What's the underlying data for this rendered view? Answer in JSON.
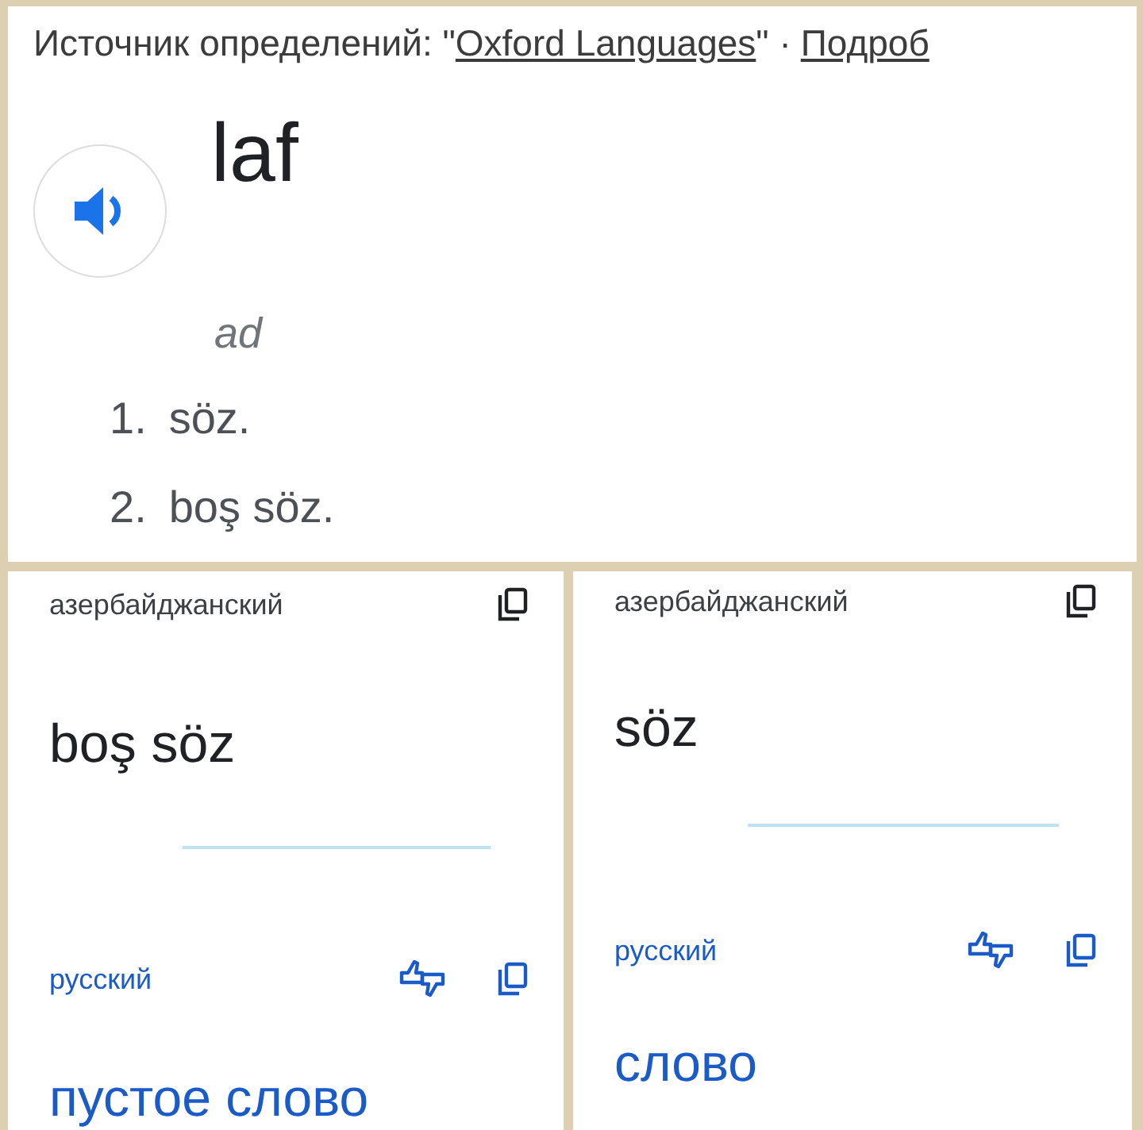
{
  "source": {
    "prefix": "Источник определений: \"",
    "link": "Oxford Languages",
    "suffix": "\" ·",
    "more_link": "Подроб"
  },
  "entry": {
    "word": "laf",
    "part_of_speech": "ad",
    "senses": [
      {
        "number": "1.",
        "text": "söz."
      },
      {
        "number": "2.",
        "text": "boş söz."
      }
    ]
  },
  "translations": [
    {
      "source_lang": "азербайджанский",
      "source_text": "boş söz",
      "target_lang": "русский",
      "target_text": "пустое слово"
    },
    {
      "source_lang": "азербайджанский",
      "source_text": "söz",
      "target_lang": "русский",
      "target_text": "слово"
    }
  ]
}
